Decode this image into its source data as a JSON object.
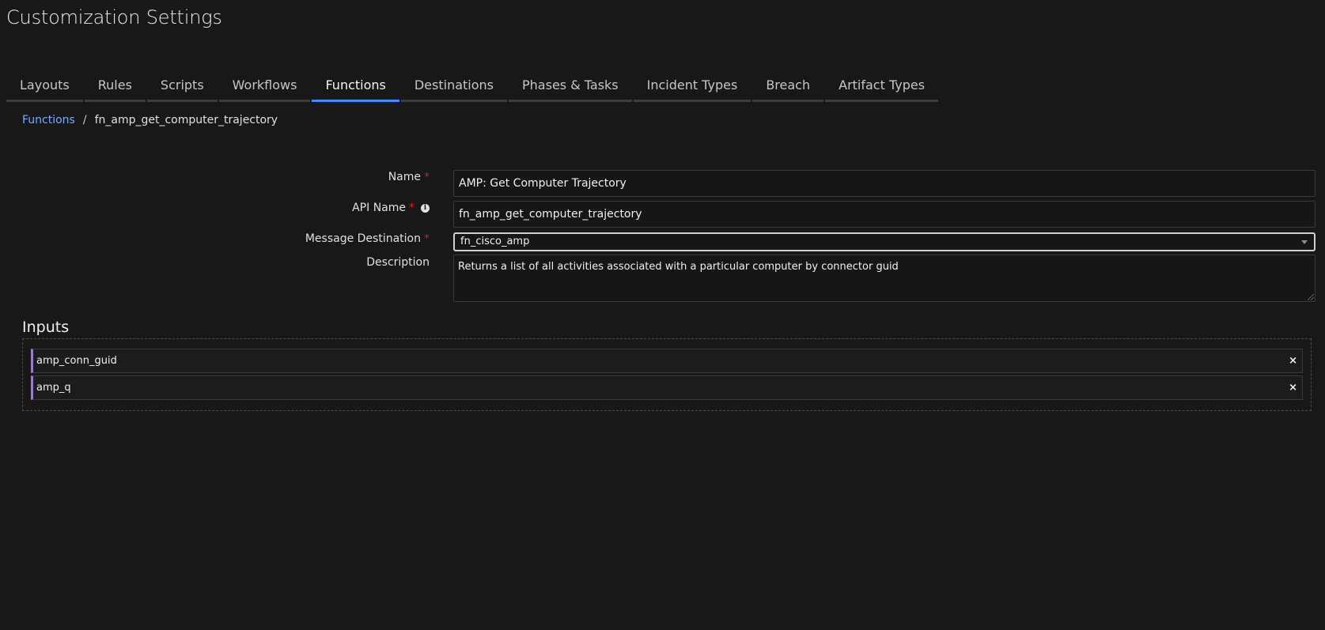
{
  "page": {
    "title": "Customization Settings"
  },
  "tabs": [
    {
      "label": "Layouts"
    },
    {
      "label": "Rules"
    },
    {
      "label": "Scripts"
    },
    {
      "label": "Workflows"
    },
    {
      "label": "Functions",
      "active": true
    },
    {
      "label": "Destinations"
    },
    {
      "label": "Phases & Tasks"
    },
    {
      "label": "Incident Types"
    },
    {
      "label": "Breach"
    },
    {
      "label": "Artifact Types"
    }
  ],
  "breadcrumb": {
    "parent": "Functions",
    "separator": "/",
    "current": "fn_amp_get_computer_trajectory"
  },
  "form": {
    "name_label": "Name",
    "name_value": "AMP: Get Computer Trajectory",
    "api_name_label": "API Name",
    "api_name_value": "fn_amp_get_computer_trajectory",
    "destination_label": "Message Destination",
    "destination_value": "fn_cisco_amp",
    "description_label": "Description",
    "description_value": "Returns a list of all activities associated with a particular computer by connector guid",
    "required_mark": "*"
  },
  "inputs": {
    "title": "Inputs",
    "items": [
      {
        "name": "amp_conn_guid"
      },
      {
        "name": "amp_q"
      }
    ],
    "remove_symbol": "×"
  },
  "colors": {
    "background": "#181818",
    "active_tab_accent": "#4589ff",
    "link": "#78a9ff",
    "required": "#da1e28",
    "input_accent": "#a56eff"
  }
}
